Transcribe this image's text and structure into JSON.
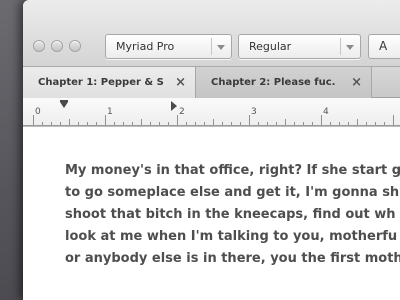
{
  "window": {
    "traffic_lights": [
      "close",
      "minimize",
      "zoom"
    ]
  },
  "toolbar": {
    "font_select_value": "Myriad Pro",
    "style_select_value": "Regular",
    "text_button_label": "A"
  },
  "tabs": [
    {
      "label": "Chapter 1: Pepper & S...",
      "close": "×",
      "active": true
    },
    {
      "label": "Chapter 2: Please fuc...",
      "close": "×",
      "active": false
    }
  ],
  "ruler": {
    "numbers": [
      "0",
      "1",
      "2",
      "3",
      "4"
    ]
  },
  "document": {
    "lines": [
      "My money's in that office, right? If she start g",
      "to go someplace else and get it, I'm gonna sh",
      "shoot that bitch in the kneecaps, find out wh",
      "look at me when I'm talking to you, motherfu",
      "or anybody else is in there, you the first moth"
    ]
  },
  "colors": {
    "desktop": "#54545a",
    "text": "#4e4e4e",
    "chrome": "#d4d4d4"
  }
}
